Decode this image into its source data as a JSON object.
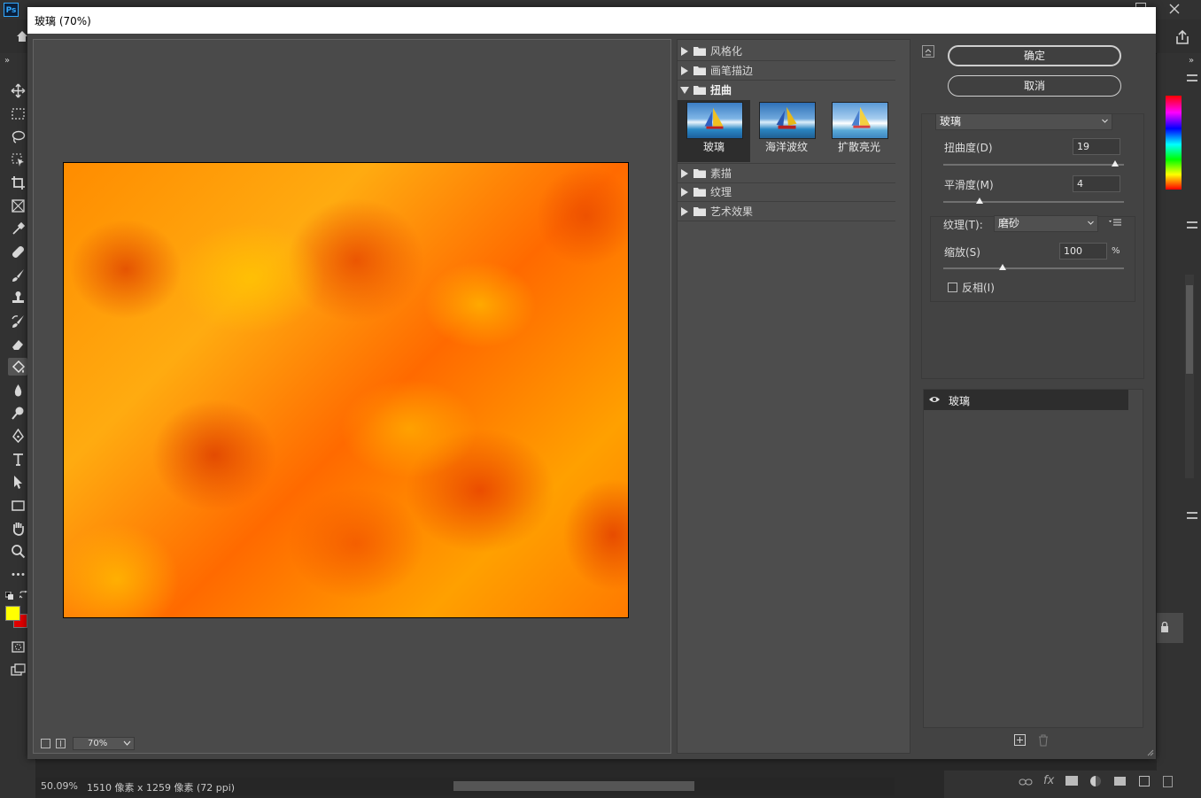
{
  "dialog": {
    "title": "玻璃 (70%)",
    "preview": {
      "zoom": "70%"
    },
    "filter_groups": [
      {
        "label": "风格化",
        "expanded": false
      },
      {
        "label": "画笔描边",
        "expanded": false
      },
      {
        "label": "扭曲",
        "expanded": true,
        "filters": [
          {
            "label": "玻璃",
            "selected": true
          },
          {
            "label": "海洋波纹",
            "selected": false
          },
          {
            "label": "扩散亮光",
            "selected": false
          }
        ]
      },
      {
        "label": "素描",
        "expanded": false
      },
      {
        "label": "纹理",
        "expanded": false
      },
      {
        "label": "艺术效果",
        "expanded": false
      }
    ],
    "buttons": {
      "ok": "确定",
      "cancel": "取消"
    },
    "filter_select": "玻璃",
    "params": {
      "distortion_label": "扭曲度(D)",
      "distortion_value": "19",
      "distortion_fraction": 0.95,
      "smoothness_label": "平滑度(M)",
      "smoothness_value": "4",
      "smoothness_fraction": 0.2,
      "texture_label": "纹理(T):",
      "texture_value": "磨砂",
      "scale_label": "缩放(S)",
      "scale_value": "100",
      "scale_unit": "%",
      "scale_fraction": 0.33,
      "invert_label": "反相(I)",
      "invert_checked": false
    },
    "effect_layers": [
      {
        "name": "玻璃",
        "visible": true
      }
    ]
  },
  "status": {
    "zoom": "50.09%",
    "doc_info": "1510 像素 x 1259 像素 (72 ppi)"
  },
  "colors": {
    "foreground": "#ffff00",
    "background": "#e00000",
    "accent": "#31a8ff"
  },
  "app": {
    "logo": "Ps"
  }
}
